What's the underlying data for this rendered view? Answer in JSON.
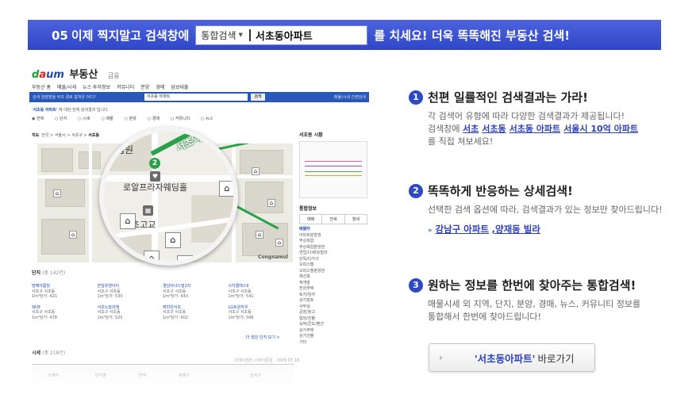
{
  "banner": {
    "step": "05",
    "lead": "이제 찍지말고 검색창에",
    "select_label": "통합검색",
    "query": "서초동아파트",
    "tail": "를 치세요! 더욱 똑똑해진 부동산 검색!"
  },
  "site": {
    "logo_name": "부동산",
    "logo_sub": "금융",
    "gnb": [
      "부동산 홈",
      "매물/시세",
      "뉴스·투자정보",
      "커뮤니티",
      "분양",
      "경매",
      "담보대출"
    ],
    "search_hint": "검색 일괄발을 무조 경로 합쳐은 어디?",
    "search_value": "서초동 아파트",
    "search_btn": "검색",
    "search_right": "매물/시세 간편검색",
    "result_query": "'서초동 아파트'",
    "result_text": "에 대한 전체 검색결과 입니다.",
    "radios": [
      "전체",
      "단지",
      "시세",
      "매물",
      "분양",
      "경매",
      "커뮤니티",
      "뉴스"
    ],
    "map_label": "지도",
    "breadcrumb": "전국 > 서울시 > 서초구 > ",
    "breadcrumb_current": "서초동",
    "congnamul": "Congnamul",
    "side_title": "서초동 시황",
    "side_title2": "통합정보",
    "side_tabs": [
      "매매",
      "전세",
      "월세"
    ],
    "side_list_head": "매물타",
    "side_list": [
      "아파트분양권",
      "주상복합",
      "주상복합분양권",
      "연립/다세대/빌라",
      "단독/다가구",
      "오피스텔",
      "오피스텔분양권",
      "재건축",
      "재개발",
      "전원주택",
      "토지/임야",
      "상가점포",
      "사무실",
      "공장/창고",
      "빌딩/건물",
      "숙박/콘도/펜션",
      "상가주택",
      "상가건물",
      "기타"
    ],
    "danji_label": "단지",
    "danji_count": "(총 142건)",
    "danji": [
      {
        "name": "방배아름힐",
        "addr": "서초구 서초동",
        "meta": "1m²당가: 421"
      },
      {
        "name": "한일유앤아이",
        "addr": "서초구 서초동",
        "meta": "1m²당가: 530"
      },
      {
        "name": "경남아너스빌1차",
        "addr": "서초구 서초동",
        "meta": "1m²당가: 643"
      },
      {
        "name": "스타클래스II",
        "addr": "서초구 서초동",
        "meta": "1m²당가: 541"
      },
      {
        "name": "SK뷰",
        "addr": "서초구 서초동",
        "meta": "1m²당가: 478"
      },
      {
        "name": "서초노빌리에",
        "addr": "서초구 서초동",
        "meta": "1m²당가: 525"
      },
      {
        "name": "래미안서초",
        "addr": "서초구 서초동",
        "meta": "1m²당가: 602"
      },
      {
        "name": "LG트윈하우",
        "addr": "서초구 서초동",
        "meta": "1m²당가: 566"
      }
    ],
    "danji_more": "더 많은 단지 보기 >",
    "sise_label": "시세",
    "sise_count": "(총 218건)",
    "sise_info": "(단위:만원) 시세기준일 : 2009.07.18",
    "sise_cols": [
      "소재지",
      "단지명",
      "면적",
      "매매가",
      "전세가"
    ]
  },
  "magnifier": {
    "court": "법원",
    "station": "서초역",
    "line_num": "2",
    "place": "로알프라자웨딩홀",
    "school": "초고교"
  },
  "features": [
    {
      "num": "1",
      "title": "천편 일률적인 검색결과는 가라!",
      "desc1": "각 검색어 유형에 따라 다양한 검색결과가 제공됩니다!",
      "desc2_prefix": "검색창에",
      "links": [
        "서초",
        "서초동",
        "서초동 아파트",
        "서울시 10억 아파트"
      ],
      "desc3": "를 직접 쳐보세요!"
    },
    {
      "num": "2",
      "title": "똑똑하게 반응하는 상세검색!",
      "desc1": "선택한 검색 옵션에 따라, 검색결과가 있는 정보만 찾아드립니다!",
      "links": [
        "강남구 아파트",
        ",양재동 빌라"
      ]
    },
    {
      "num": "3",
      "title": "원하는 정보를 한번에 찾아주는 통합검색!",
      "desc1": "매물시세 외 지역, 단지, 분양, 경매, 뉴스, 커뮤니티 정보를",
      "desc2": "통합해서 한번에 찾아드립니다!"
    }
  ],
  "go_button": {
    "query": "'서초동아파트'",
    "label": "바로가기"
  },
  "colors": {
    "banner": "#2f46c8",
    "link": "#2c3fc0",
    "subway_green": "#2aa24a"
  }
}
